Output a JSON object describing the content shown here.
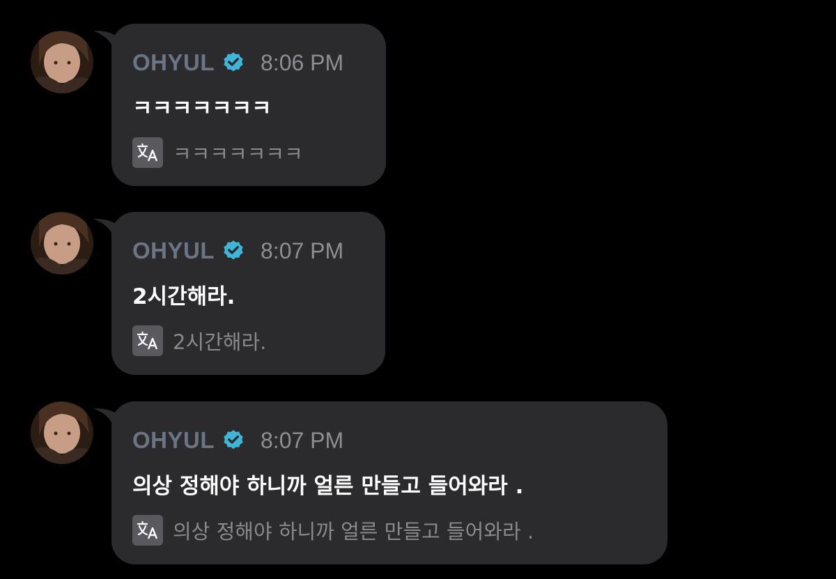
{
  "messages": [
    {
      "sender": "OHYUL",
      "time": "8:06 PM",
      "text": "ㅋㅋㅋㅋㅋㅋㅋ",
      "translation": "ㅋㅋㅋㅋㅋㅋㅋ"
    },
    {
      "sender": "OHYUL",
      "time": "8:07 PM",
      "text": "2시간해라.",
      "translation": "2시간해라."
    },
    {
      "sender": "OHYUL",
      "time": "8:07 PM",
      "text": "의상 정해야 하니까 얼른 만들고 들어와라 .",
      "translation": "의상 정해야 하니까 얼른 만들고 들어와라 ."
    }
  ],
  "icons": {
    "verified": "verified-badge-icon",
    "translate": "translate-icon"
  },
  "colors": {
    "background": "#000000",
    "bubble": "#2b2b2d",
    "sender_name": "#6b7585",
    "verified_badge": "#3fb6d8",
    "timestamp": "#8e8e93",
    "message_text": "#ffffff",
    "translation_text": "#8a8a8e"
  }
}
